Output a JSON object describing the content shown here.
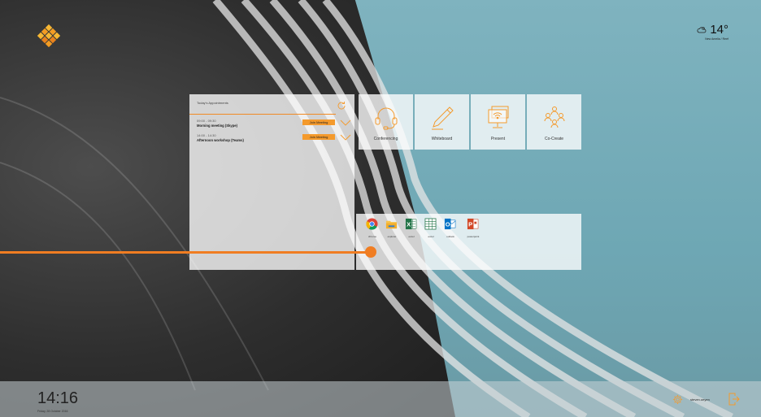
{
  "colors": {
    "accent": "#f07d22",
    "button": "#f49a2c"
  },
  "weather": {
    "temperature": "14°",
    "location": "New Amelia / Reef",
    "icon": "cloud-sun-icon"
  },
  "appointments": {
    "heading": "Today's Appointments",
    "items": [
      {
        "time": "09:00 - 09:30",
        "title": "Morning meeting (Skype)",
        "button": "Join Meeting"
      },
      {
        "time": "14:00 - 14:30",
        "title": "Afternoon workshop (Teams)",
        "button": "Join Meeting"
      }
    ]
  },
  "tiles": [
    {
      "label": "Conferencing",
      "icon": "headset-icon"
    },
    {
      "label": "Whiteboard",
      "icon": "pen-icon"
    },
    {
      "label": "Present",
      "icon": "present-screen-icon"
    },
    {
      "label": "Co-Create",
      "icon": "people-group-icon"
    }
  ],
  "apps": [
    {
      "label": "chrome",
      "icon": "chrome-icon"
    },
    {
      "label": "explorer",
      "icon": "folder-icon"
    },
    {
      "label": "excel",
      "icon": "excel-icon"
    },
    {
      "label": "excel",
      "icon": "excel-icon"
    },
    {
      "label": "outlook",
      "icon": "outlook-icon"
    },
    {
      "label": "powerpoint",
      "icon": "powerpoint-icon"
    }
  ],
  "footer": {
    "time": "14:16",
    "date": "Friday, 28 October 2016",
    "user": "steven.oeyen"
  }
}
